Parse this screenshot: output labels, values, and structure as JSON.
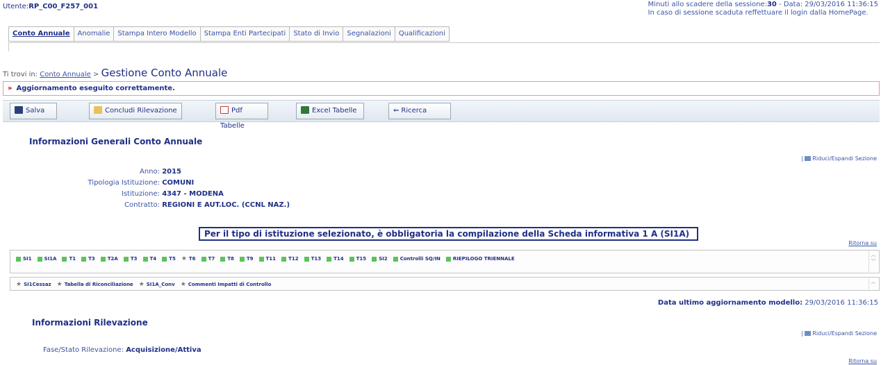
{
  "header": {
    "user_label": "Utente:",
    "user_value": "RP_C00_F257_001",
    "session_line1_prefix": "Minuti allo scadere della sessione:",
    "session_minutes": "30",
    "session_line1_suffix": " -  Data: 29/03/2016 11:36:15",
    "session_line2": "In caso di sessione scaduta reffettuare il login dalla HomePage."
  },
  "tabs": [
    {
      "label": "Conto Annuale",
      "active": true
    },
    {
      "label": "Anomalie"
    },
    {
      "label": "Stampa Intero Modello"
    },
    {
      "label": "Stampa Enti Partecipati"
    },
    {
      "label": "Stato di Invio"
    },
    {
      "label": "Segnalazioni"
    },
    {
      "label": "Qualificazioni"
    }
  ],
  "breadcrumb": {
    "prefix": "Ti trovi in:",
    "link": "Conto Annuale",
    "sep": ">",
    "title": "Gestione Conto Annuale"
  },
  "message": {
    "arrow": "»",
    "text": "Aggiornamento eseguito correttamente."
  },
  "toolbar": {
    "save": "Salva",
    "conclude": "Concludi Rilevazione",
    "pdf": "Pdf Tabelle",
    "excel": "Excel Tabelle",
    "search": "Ricerca"
  },
  "info": {
    "title": "Informazioni Generali Conto Annuale",
    "riduci": "Riduci/Espandi Sezione",
    "fields": [
      {
        "label": "Anno:",
        "value": "2015"
      },
      {
        "label": "Tipologia Istituzione:",
        "value": "COMUNI"
      },
      {
        "label": "Istituzione:",
        "value": "4347  -  MODENA"
      },
      {
        "label": "Contratto:",
        "value": "REGIONI E AUT.LOC. (CCNL NAZ.)"
      }
    ]
  },
  "notice": "Per il tipo di istituzione selezionato, è obbligatoria la compilazione della Scheda informativa 1 A (SI1A)",
  "ritorna": "Ritorna su",
  "schede": {
    "row1": [
      "SI1",
      "SI1A",
      "T1",
      "T3",
      "T2A",
      "T3",
      "T4",
      "T5",
      "T6",
      "T7",
      "T8",
      "T9",
      "T11",
      "T12",
      "T13",
      "T14",
      "T15",
      "SI2",
      "Controlli SQ/IN",
      "RIEPILOGO TRIENNALE"
    ],
    "row2": [
      "SI1Cessaz",
      "Tabella di Riconciliazione",
      "SI1A_Conv",
      "Commenti Impatti di Controllo"
    ]
  },
  "last_update": {
    "label": "Data ultimo aggiornamento modello:",
    "value": "29/03/2016 11:36:15"
  },
  "rilevazione": {
    "title": "Informazioni Rilevazione",
    "riduci": "Riduci/Espandi Sezione",
    "field_label": "Fase/Stato Rilevazione:",
    "field_value": "Acquisizione/Attiva",
    "ritorna": "Ritorna su"
  },
  "colors": {
    "navy": "#1f2f86",
    "link": "#3b53a5",
    "ok_green": "#5cc25c",
    "error_border": "#e69a9a"
  }
}
